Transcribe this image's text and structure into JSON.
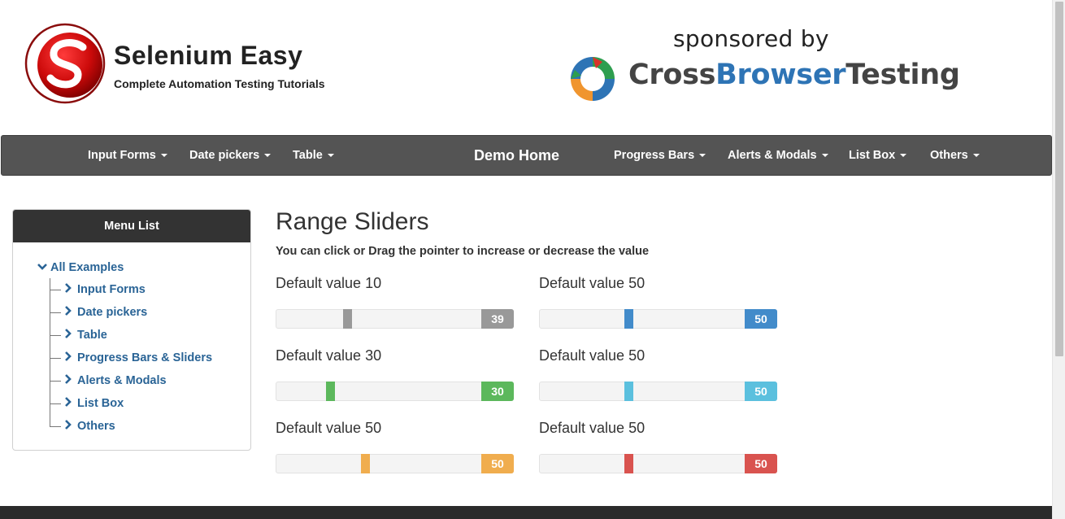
{
  "header": {
    "title": "Selenium Easy",
    "tagline": "Complete Automation Testing Tutorials",
    "sponsor_text": "sponsored by",
    "sponsor_name_part1": "Cross",
    "sponsor_name_part2": "Browser",
    "sponsor_name_part3": "Testing"
  },
  "navbar": {
    "items": [
      {
        "label": "Input Forms"
      },
      {
        "label": "Date pickers"
      },
      {
        "label": "Table"
      },
      {
        "label": "Demo Home"
      },
      {
        "label": "Progress Bars"
      },
      {
        "label": "Alerts & Modals"
      },
      {
        "label": "List Box"
      },
      {
        "label": "Others"
      }
    ]
  },
  "sidebar": {
    "title": "Menu List",
    "root": "All Examples",
    "items": [
      {
        "label": "Input Forms"
      },
      {
        "label": "Date pickers"
      },
      {
        "label": "Table"
      },
      {
        "label": "Progress Bars & Sliders"
      },
      {
        "label": "Alerts & Modals"
      },
      {
        "label": "List Box"
      },
      {
        "label": "Others"
      }
    ]
  },
  "main": {
    "title": "Range Sliders",
    "subtitle": "You can click or Drag the pointer to increase or decrease the value",
    "sliders": [
      {
        "label": "Default value 10",
        "value": "39",
        "level": 0.34,
        "color": "#999999"
      },
      {
        "label": "Default value 50",
        "value": "50",
        "level": 0.43,
        "color": "#428bca"
      },
      {
        "label": "Default value 30",
        "value": "30",
        "level": 0.25,
        "color": "#5cb85c"
      },
      {
        "label": "Default value 50",
        "value": "50",
        "level": 0.43,
        "color": "#5bc0de"
      },
      {
        "label": "Default value 50",
        "value": "50",
        "level": 0.43,
        "color": "#f0ad4e"
      },
      {
        "label": "Default value 50",
        "value": "50",
        "level": 0.43,
        "color": "#d9534f"
      }
    ]
  },
  "icons": {
    "logo": "selenium-easy-logo-icon",
    "sponsor_logo": "crossbrowsertesting-logo-icon",
    "nav_caret": "caret-down-icon",
    "tree_root": "chevron-down-icon",
    "tree_item": "chevron-right-icon"
  }
}
